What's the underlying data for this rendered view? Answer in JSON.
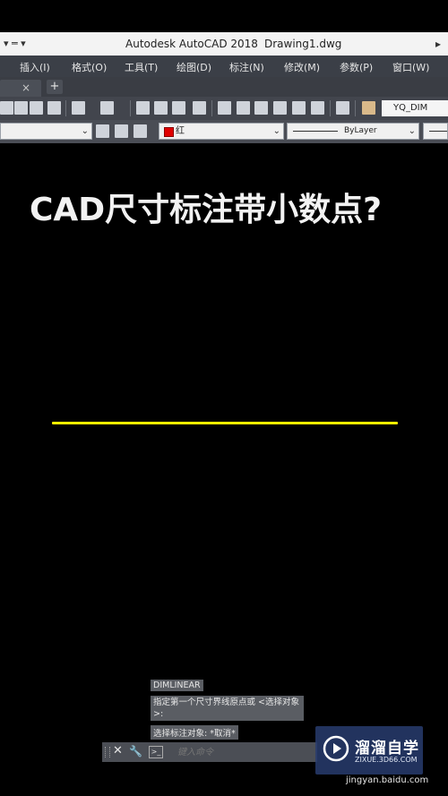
{
  "titlebar": {
    "app_title": "Autodesk AutoCAD 2018",
    "document": "Drawing1.dwg"
  },
  "menubar": {
    "items": [
      "插入(I)",
      "格式(O)",
      "工具(T)",
      "绘图(D)",
      "标注(N)",
      "修改(M)",
      "参数(P)",
      "窗口(W)"
    ]
  },
  "tabs": {
    "close_glyph": "×",
    "add_glyph": "+"
  },
  "toolbar": {
    "dim_style": "YQ_DIM"
  },
  "properties": {
    "color_label": "红",
    "color_hex": "#e00000",
    "linetype_label": "ByLayer"
  },
  "canvas": {
    "heading": "CAD尺寸标注带小数点?",
    "line_color": "#ffef00"
  },
  "command": {
    "history": [
      "DIMLINEAR",
      "指定第一个尺寸界线原点或 <选择对象>:",
      "选择标注对象: *取消*"
    ],
    "placeholder": "键入命令"
  },
  "watermark": {
    "brand": "溜溜自学",
    "domain": "ZIXUE.3D66.COM",
    "source_url": "jingyan.baidu.com"
  }
}
